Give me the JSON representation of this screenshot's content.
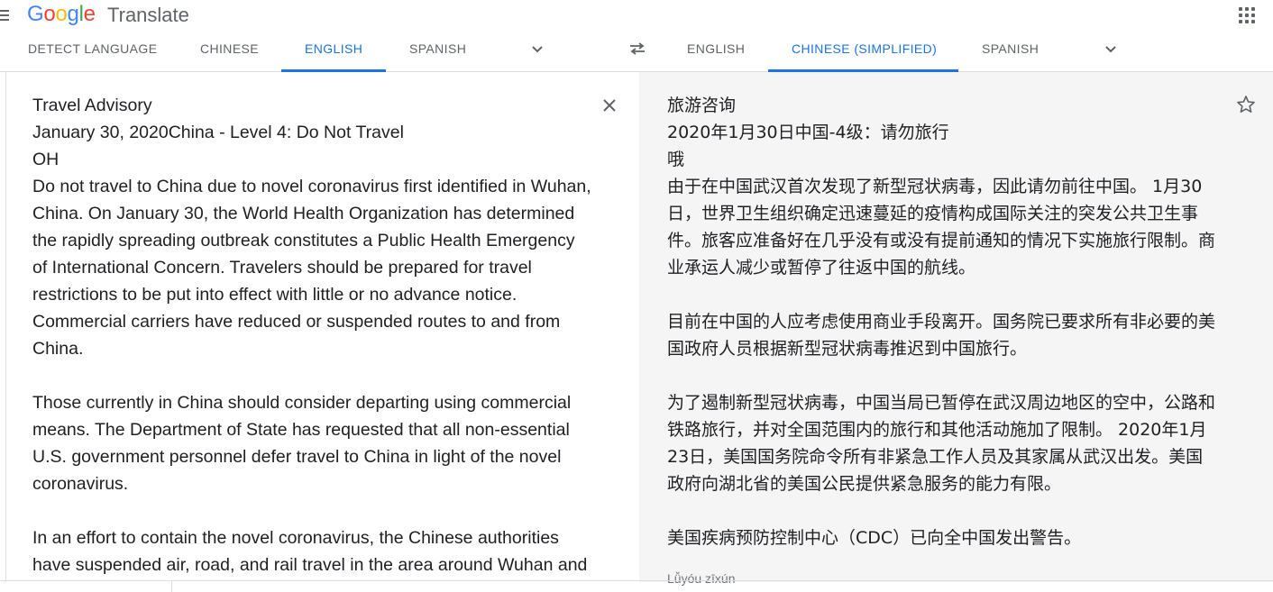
{
  "header": {
    "logo": "Google",
    "product": "Translate",
    "menu_icon": "menu-icon",
    "apps_icon": "apps-grid-icon"
  },
  "source_tabs": [
    {
      "label": "DETECT LANGUAGE",
      "active": false
    },
    {
      "label": "CHINESE",
      "active": false
    },
    {
      "label": "ENGLISH",
      "active": true
    },
    {
      "label": "SPANISH",
      "active": false
    }
  ],
  "target_tabs": [
    {
      "label": "ENGLISH",
      "active": false
    },
    {
      "label": "CHINESE (SIMPLIFIED)",
      "active": true
    },
    {
      "label": "SPANISH",
      "active": false
    }
  ],
  "source": {
    "lines": [
      "Travel Advisory",
      "January 30, 2020China - Level 4: Do Not Travel",
      "OH",
      "Do not travel to China due to novel coronavirus first identified in Wuhan, China. On January 30, the World Health Organization has determined the rapidly spreading outbreak constitutes a Public Health Emergency of International Concern. Travelers should be prepared for travel restrictions to be put into effect with little or no advance notice. Commercial carriers have reduced or suspended routes to and from China.",
      "",
      "Those currently in China should consider departing using commercial means. The Department of State has requested that all non-essential U.S. government personnel defer travel to China in light of the novel coronavirus.",
      "",
      "In an effort to contain the novel coronavirus, the Chinese authorities have suspended air, road, and rail travel in the area around Wuhan and"
    ]
  },
  "target": {
    "lines": [
      "旅游咨询",
      "2020年1月30日中国-4级：请勿旅行",
      "哦",
      "由于在中国武汉首次发现了新型冠状病毒，因此请勿前往中国。 1月30日，世界卫生组织确定迅速蔓延的疫情构成国际关注的突发公共卫生事件。旅客应准备好在几乎没有或没有提前通知的情况下实施旅行限制。商业承运人减少或暂停了往返中国的航线。",
      "",
      "目前在中国的人应考虑使用商业手段离开。国务院已要求所有非必要的美国政府人员根据新型冠状病毒推迟到中国旅行。",
      "",
      "为了遏制新型冠状病毒，中国当局已暂停在武汉周边地区的空中，公路和铁路旅行，并对全国范围内的旅行和其他活动施加了限制。 2020年1月23日，美国国务院命令所有非紧急工作人员及其家属从武汉出发。美国政府向湖北省的美国公民提供紧急服务的能力有限。",
      "",
      "美国疾病预防控制中心（CDC）已向全中国发出警告。"
    ],
    "transliteration": "Lǚyóu zīxún"
  }
}
